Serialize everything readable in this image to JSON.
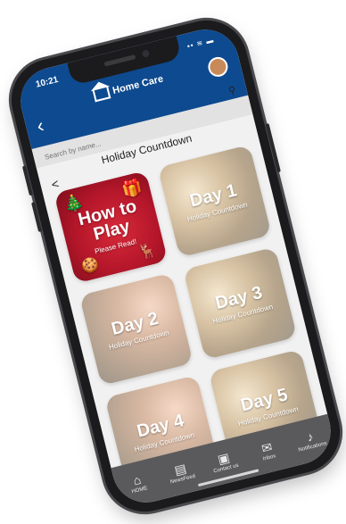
{
  "status": {
    "time": "10:21",
    "icons": "▪▪ ≋ ▬"
  },
  "header": {
    "title": "Home Care"
  },
  "search": {
    "placeholder": "Search by name..."
  },
  "page": {
    "title": "Holiday Countdown"
  },
  "tiles": [
    {
      "title": "How to Play",
      "subtitle": "Please Read!"
    },
    {
      "title": "Day 1",
      "subtitle": "Holiday Countdown"
    },
    {
      "title": "Day 2",
      "subtitle": "Holiday Countdown"
    },
    {
      "title": "Day 3",
      "subtitle": "Holiday Countdown"
    },
    {
      "title": "Day 4",
      "subtitle": "Holiday Countdown"
    },
    {
      "title": "Day 5",
      "subtitle": "Holiday Countdown"
    }
  ],
  "nav": [
    {
      "label": "HOME",
      "icon": "home-icon"
    },
    {
      "label": "NewsFeed",
      "icon": "newsfeed-icon"
    },
    {
      "label": "Contact us",
      "icon": "contact-icon"
    },
    {
      "label": "Inbox",
      "icon": "mail-icon"
    },
    {
      "label": "Notifications",
      "icon": "bell-icon"
    }
  ],
  "colors": {
    "header": "#0e4a8f",
    "nav": "#5a5a5c",
    "howto_tile": "#b5162a",
    "background": "#f1f1f1"
  }
}
